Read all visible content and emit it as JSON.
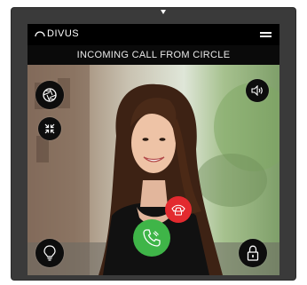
{
  "header": {
    "brand": "DIVUS",
    "menu_icon": "hamburger-menu-icon"
  },
  "call": {
    "status_text": "INCOMING CALL FROM CIRCLE"
  },
  "controls": {
    "camera_icon": "camera-shutter-icon",
    "collapse_icon": "collapse-arrows-icon",
    "speaker_icon": "speaker-volume-icon",
    "light_icon": "light-bulb-icon",
    "door_icon": "padlock-icon",
    "answer_icon": "phone-answer-icon",
    "hangup_icon": "phone-hangup-icon"
  },
  "colors": {
    "answer": "#3fb548",
    "hangup": "#e32a2f",
    "frame": "#3a3a3a"
  }
}
